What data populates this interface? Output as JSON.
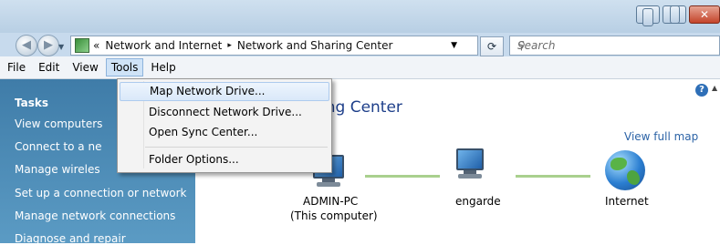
{
  "address": {
    "breadcrumb_prefix": "«",
    "crumbs": [
      "Network and Internet",
      "Network and Sharing Center"
    ],
    "separator": "▸",
    "search_placeholder": "Search"
  },
  "menubar": {
    "items": [
      "File",
      "Edit",
      "View",
      "Tools",
      "Help"
    ],
    "active": "Tools"
  },
  "tools_menu": {
    "items": [
      "Map Network Drive...",
      "Disconnect Network Drive...",
      "Open Sync Center...",
      "Folder Options..."
    ]
  },
  "sidebar": {
    "heading": "Tasks",
    "items": [
      "View computers",
      "Connect to a ne",
      "Manage wireles",
      "Set up a connection or network",
      "Manage network connections",
      "Diagnose and repair"
    ]
  },
  "content": {
    "title_partial": "ing Center",
    "view_full_map": "View full map",
    "nodes": [
      {
        "name": "ADMIN-PC",
        "sub": "(This computer)"
      },
      {
        "name": "engarde"
      },
      {
        "name": "Internet"
      }
    ]
  },
  "icons": {
    "back": "back-arrow-icon",
    "forward": "forward-arrow-icon",
    "refresh": "refresh-icon",
    "search": "search-icon",
    "help": "help-icon"
  }
}
